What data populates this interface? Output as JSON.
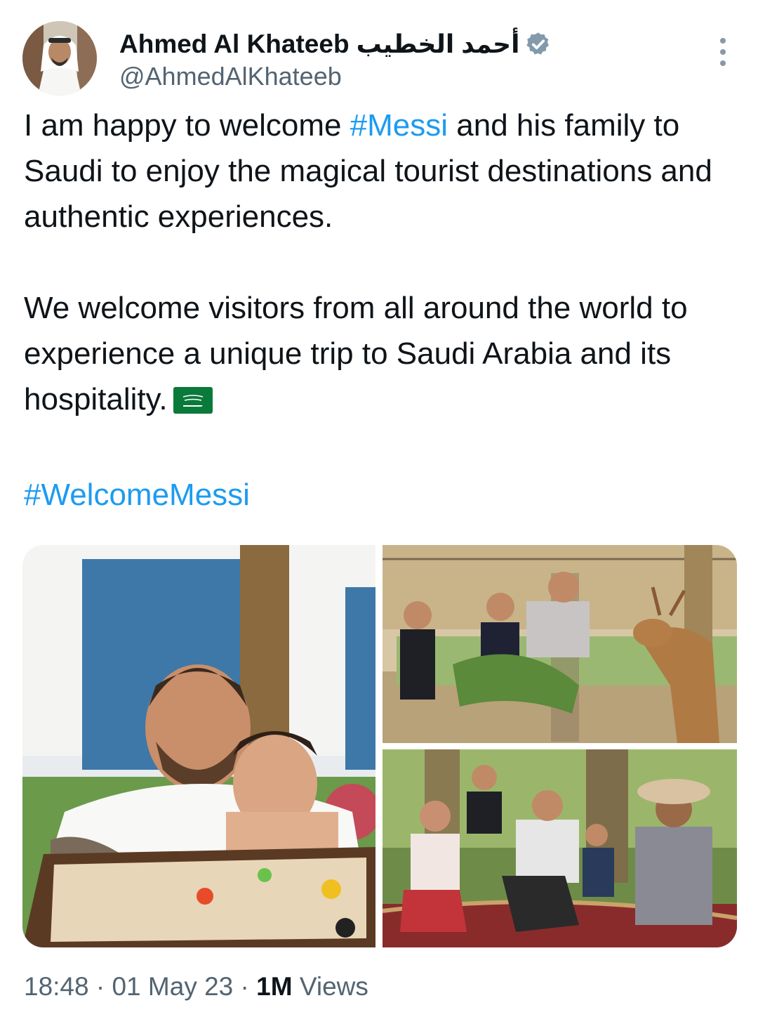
{
  "author": {
    "display_name": "Ahmed Al Khateeb",
    "display_name_arabic": "أحمد الخطيب",
    "handle": "@AhmedAlKhateeb",
    "verified": true,
    "avatar_icon": "profile-photo"
  },
  "tweet": {
    "p1_before": "I am happy to welcome ",
    "p1_hashtag": "#Messi",
    "p1_after": " and his family to Saudi to enjoy the magical tourist destinations and authentic experiences.",
    "p2": "We welcome visitors from all around the world to experience a unique trip to Saudi Arabia and its hospitality.",
    "p2_emoji": "saudi-flag-emoji",
    "hashtag_footer": "#WelcomeMessi"
  },
  "media": {
    "photos": [
      "photo-carrom-board",
      "photo-deer-feeding",
      "photo-family-picnic"
    ]
  },
  "meta": {
    "time": "18:48",
    "sep1": " · ",
    "date": "01 May 23",
    "sep2": " · ",
    "views_count": "1M",
    "views_label": " Views"
  },
  "colors": {
    "link": "#1d9bf0",
    "text": "#0f1419",
    "secondary": "#536471",
    "verified_badge": "#829aab"
  }
}
